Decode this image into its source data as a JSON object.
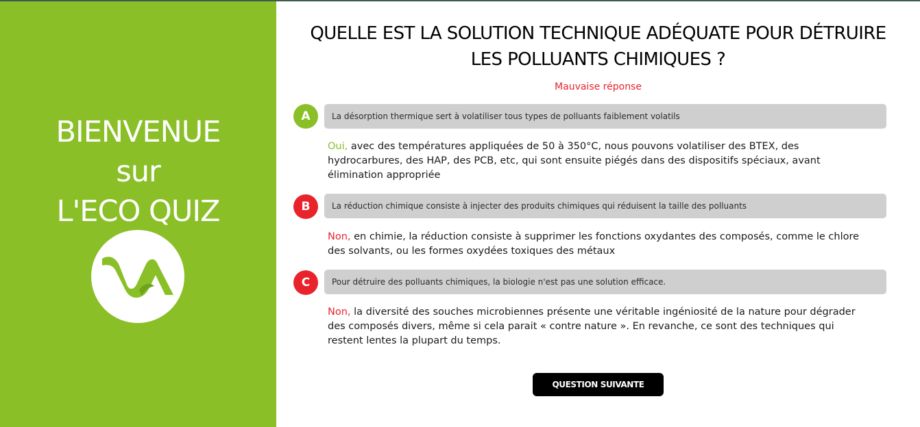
{
  "colors": {
    "accent_green": "#8abf27",
    "error_red": "#e8232c",
    "answer_bg": "#cfcfcf",
    "button_bg": "#000000"
  },
  "sidebar": {
    "welcome_lines": [
      "BIENVENUE",
      "sur",
      "L'ECO QUIZ"
    ],
    "logo_icon": "va-logo-icon"
  },
  "quiz": {
    "question_lines": [
      "QUELLE EST LA SOLUTION TECHNIQUE ADÉQUATE POUR DÉTRUIRE",
      "LES POLLUANTS CHIMIQUES ?"
    ],
    "verdict": "Mauvaise réponse",
    "answers": [
      {
        "letter": "A",
        "status": "correct",
        "text": "La désorption thermique sert à volatiliser tous types de polluants faiblement volatils",
        "lead": "Oui,",
        "explanation": " avec des températures appliquées de 50 à 350°C, nous pouvons volatiliser des BTEX, des hydrocarbures, des HAP, des PCB, etc, qui sont ensuite piégés dans des dispositifs spéciaux, avant élimination appropriée"
      },
      {
        "letter": "B",
        "status": "incorrect",
        "text": "La réduction chimique consiste à injecter des produits chimiques qui réduisent la taille des polluants",
        "lead": "Non,",
        "explanation": " en chimie, la réduction consiste à supprimer les fonctions oxydantes des composés, comme le chlore des solvants, ou les formes oxydées toxiques des métaux"
      },
      {
        "letter": "C",
        "status": "incorrect",
        "text": "Pour détruire des polluants chimiques, la biologie n'est pas une solution efficace.",
        "lead": "Non,",
        "explanation": " la diversité des souches microbiennes présente une véritable ingéniosité de la nature pour dégrader des composés divers, même si cela parait « contre nature ». En revanche, ce sont des techniques qui restent lentes la plupart du temps."
      }
    ],
    "next_button": "QUESTION SUIVANTE"
  }
}
